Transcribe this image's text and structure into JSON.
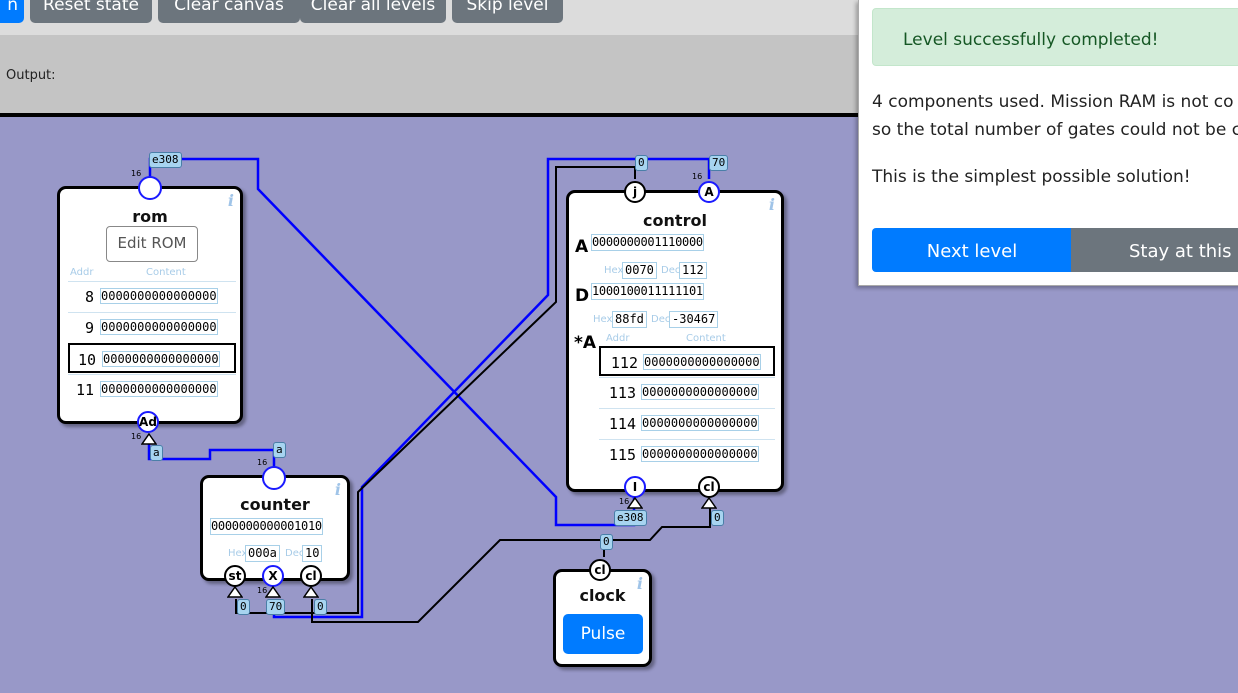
{
  "toolbar": {
    "partial_button": "n",
    "reset_state": "Reset state",
    "clear_canvas": "Clear canvas",
    "clear_all_levels": "Clear all levels",
    "skip_level": "Skip level"
  },
  "output": {
    "label": "Output:"
  },
  "rom": {
    "title": "rom",
    "edit_button": "Edit ROM",
    "addr_header": "Addr",
    "content_header": "Content",
    "rows": [
      {
        "addr": "8",
        "content": "0000000000000000"
      },
      {
        "addr": "9",
        "content": "0000000000000000"
      },
      {
        "addr": "10",
        "content": "0000000000000000"
      },
      {
        "addr": "11",
        "content": "0000000000000000"
      }
    ],
    "in_bits": "16",
    "out_bits": "16",
    "in_wire_value": "e308",
    "addr_pin": "Ad",
    "addr_wire_value": "a"
  },
  "counter": {
    "title": "counter",
    "value_bits": "0000000000001010",
    "hex_label": "Hex",
    "hex_value": "000a",
    "dec_label": "Dec",
    "dec_value": "10",
    "in_bits": "16",
    "out_bits": "16",
    "out_wire_value": "a",
    "pin_st": "st",
    "pin_x": "X",
    "pin_cl": "cl",
    "st_value": "0",
    "x_value": "70",
    "cl_value": "0"
  },
  "control": {
    "title": "control",
    "pin_j": "j",
    "pin_a": "A",
    "j_value": "0",
    "a_value": "70",
    "a_bits_label": "16",
    "reg_a_label": "A",
    "reg_a_bits": "0000000001110000",
    "reg_a_hex_label": "Hex",
    "reg_a_hex": "0070",
    "reg_a_dec_label": "Dec",
    "reg_a_dec": "112",
    "reg_d_label": "D",
    "reg_d_bits": "1000100011111101",
    "reg_d_hex_label": "Hex",
    "reg_d_hex": "88fd",
    "reg_d_dec_label": "Dec",
    "reg_d_dec": "-30467",
    "mem_label": "*A",
    "addr_header": "Addr",
    "content_header": "Content",
    "rows": [
      {
        "addr": "112",
        "content": "0000000000000000"
      },
      {
        "addr": "113",
        "content": "0000000000000000"
      },
      {
        "addr": "114",
        "content": "0000000000000000"
      },
      {
        "addr": "115",
        "content": "0000000000000000"
      }
    ],
    "pin_i": "I",
    "pin_cl": "cl",
    "i_bits_label": "16",
    "i_value": "e308",
    "cl_value": "0"
  },
  "clock": {
    "title": "clock",
    "pin": "cl",
    "out_value": "0",
    "pulse_button": "Pulse"
  },
  "panel": {
    "success": "Level successfully completed!",
    "line1": "4 components used. Mission RAM is not co",
    "line2": "so the total number of gates could not be c",
    "line3": "This is the simplest possible solution!",
    "next_button": "Next level",
    "stay_button": "Stay at this le"
  },
  "colors": {
    "canvas_bg": "#9898c8",
    "wire_blue": "#0000ff",
    "wire_black": "#000000",
    "primary": "#007bff",
    "secondary": "#6c757d",
    "success_bg": "#d4edda"
  },
  "icons": [
    "info-icon"
  ]
}
